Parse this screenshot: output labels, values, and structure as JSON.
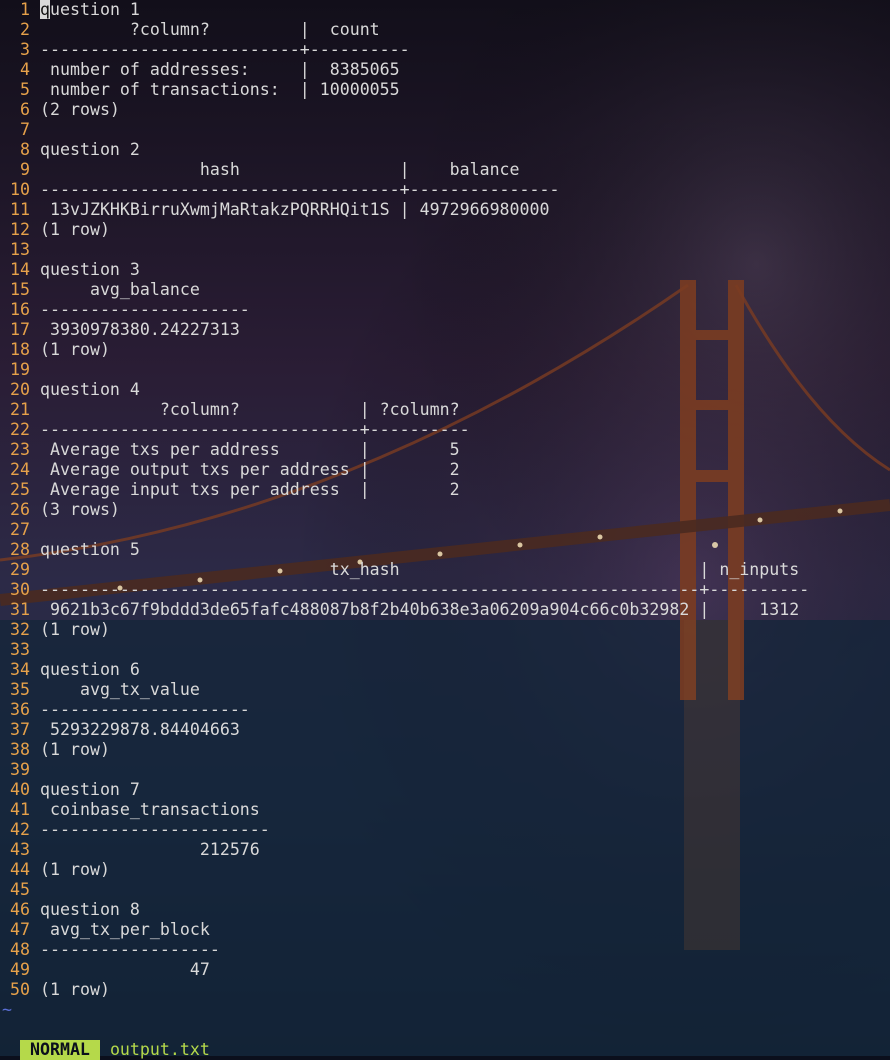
{
  "editor": {
    "lines": [
      "question 1",
      "         ?column?         |  count",
      "--------------------------+----------",
      " number of addresses:     |  8385065",
      " number of transactions:  | 10000055",
      "(2 rows)",
      "",
      "question 2",
      "                hash                |    balance",
      "------------------------------------+---------------",
      " 13vJZKHKBirruXwmjMaRtakzPQRRHQit1S | 4972966980000",
      "(1 row)",
      "",
      "question 3",
      "     avg_balance",
      "---------------------",
      " 3930978380.24227313",
      "(1 row)",
      "",
      "question 4",
      "            ?column?            | ?column?",
      "--------------------------------+----------",
      " Average txs per address        |        5",
      " Average output txs per address |        2",
      " Average input txs per address  |        2",
      "(3 rows)",
      "",
      "question 5",
      "                             tx_hash                              | n_inputs",
      "------------------------------------------------------------------+----------",
      " 9621b3c67f9bddd3de65fafc488087b8f2b40b638e3a06209a904c66c0b32982 |     1312",
      "(1 row)",
      "",
      "question 6",
      "    avg_tx_value",
      "---------------------",
      " 5293229878.84404663",
      "(1 row)",
      "",
      "question 7",
      " coinbase_transactions",
      "-----------------------",
      "                212576",
      "(1 row)",
      "",
      "question 8",
      " avg_tx_per_block",
      "------------------",
      "               47",
      "(1 row)"
    ],
    "empty_line_marker": "~"
  },
  "statusbar": {
    "mode": "NORMAL",
    "filename": "output.txt"
  },
  "colors": {
    "line_numbers": "#e6a14a",
    "text": "#d9d9d9",
    "mode_bg": "#b5d94a",
    "filename": "#b5d94a",
    "tilde": "#5a6fd6"
  }
}
